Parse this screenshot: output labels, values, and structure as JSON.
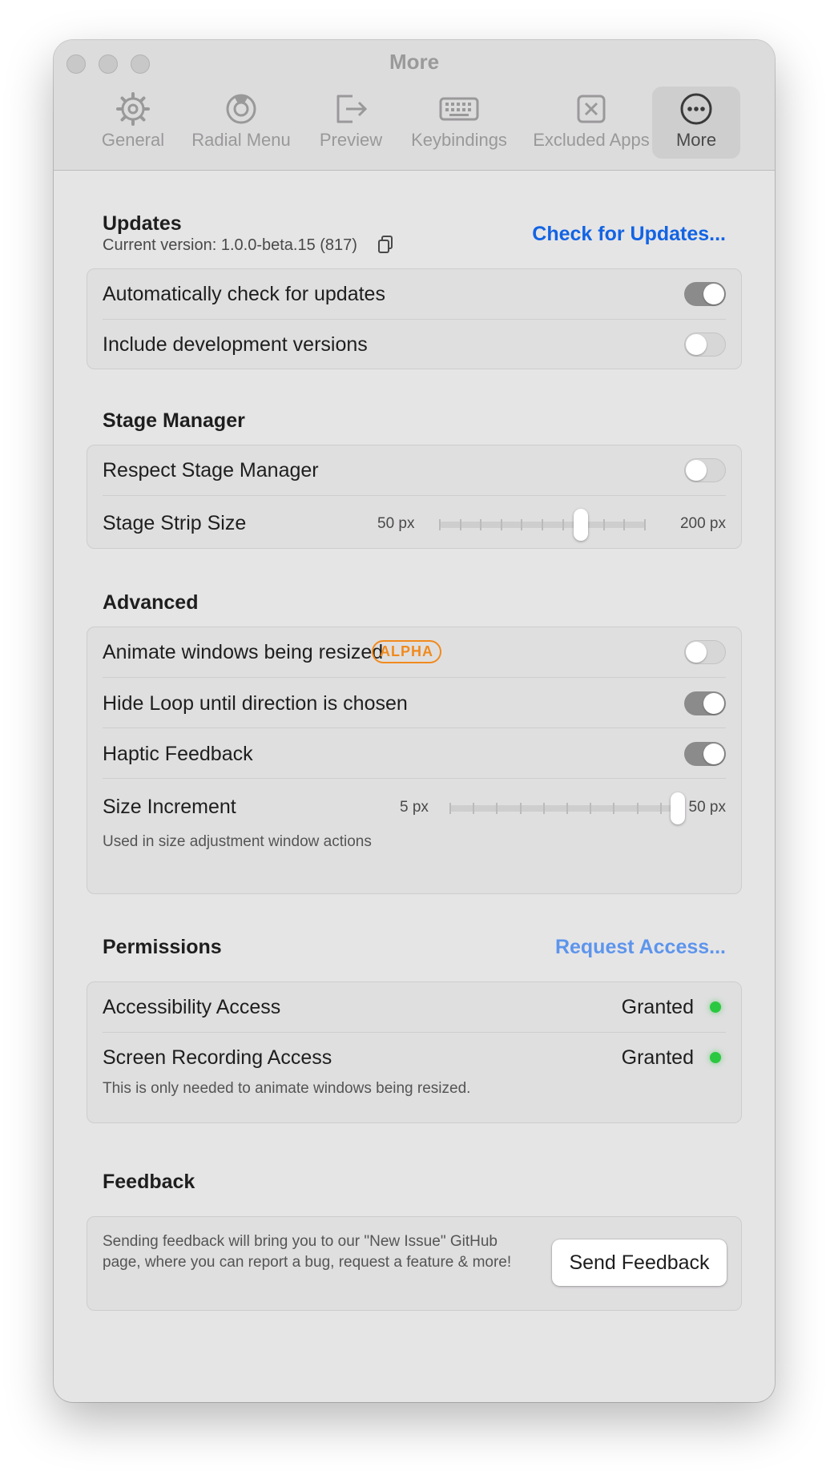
{
  "window": {
    "title": "More"
  },
  "tabs": [
    {
      "label": "General",
      "icon": "gear-icon"
    },
    {
      "label": "Radial Menu",
      "icon": "radial-menu-icon"
    },
    {
      "label": "Preview",
      "icon": "preview-icon"
    },
    {
      "label": "Keybindings",
      "icon": "keyboard-icon"
    },
    {
      "label": "Excluded Apps",
      "icon": "excluded-apps-icon"
    },
    {
      "label": "More",
      "icon": "ellipsis-icon",
      "active": true
    }
  ],
  "updates": {
    "title": "Updates",
    "version_text": "Current version: 1.0.0-beta.15 (817)",
    "check_button": "Check for Updates...",
    "auto_check_label": "Automatically check for updates",
    "auto_check_on": true,
    "dev_versions_label": "Include development versions",
    "dev_versions_on": false
  },
  "stage_manager": {
    "title": "Stage Manager",
    "respect_label": "Respect Stage Manager",
    "respect_on": false,
    "strip_size_label": "Stage Strip Size",
    "strip_min": "50 px",
    "strip_max": "200 px",
    "strip_value_fraction": 0.7
  },
  "advanced": {
    "title": "Advanced",
    "animate_label": "Animate windows being resized",
    "animate_badge": "ALPHA",
    "animate_on": false,
    "hide_loop_label": "Hide Loop until direction is chosen",
    "hide_loop_on": true,
    "haptic_label": "Haptic Feedback",
    "haptic_on": true,
    "size_increment_label": "Size Increment",
    "size_min": "5 px",
    "size_max": "50 px",
    "size_value_fraction": 1.0,
    "size_increment_caption": "Used in size adjustment window actions"
  },
  "permissions": {
    "title": "Permissions",
    "request_button": "Request Access...",
    "accessibility_label": "Accessibility Access",
    "accessibility_status": "Granted",
    "screen_recording_label": "Screen Recording Access",
    "screen_recording_status": "Granted",
    "screen_recording_caption": "This is only needed to animate windows being resized.",
    "status_color": "#2ac840"
  },
  "feedback": {
    "title": "Feedback",
    "description": "Sending feedback will bring you to our \"New Issue\" GitHub page, where you can report a bug, request a feature & more!",
    "button": "Send Feedback"
  },
  "colors": {
    "accent": "#1264e3",
    "alpha_badge": "#f08a1c"
  }
}
